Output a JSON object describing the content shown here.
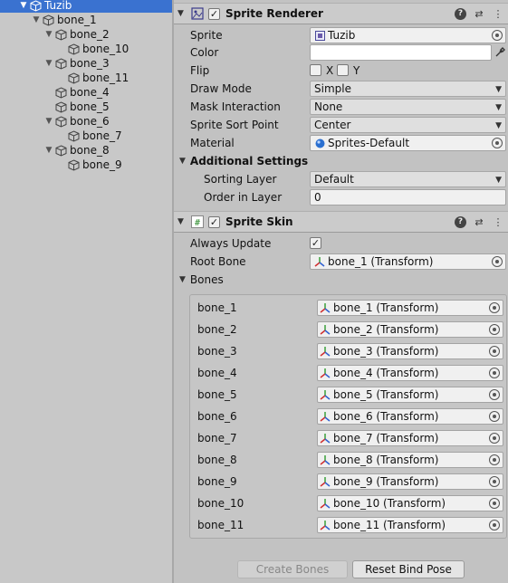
{
  "hierarchy": [
    {
      "name": "Tuzib",
      "depth": 0,
      "expanded": true,
      "selected": true
    },
    {
      "name": "bone_1",
      "depth": 1,
      "expanded": true
    },
    {
      "name": "bone_2",
      "depth": 2,
      "expanded": true
    },
    {
      "name": "bone_10",
      "depth": 3,
      "expanded": null
    },
    {
      "name": "bone_3",
      "depth": 2,
      "expanded": true
    },
    {
      "name": "bone_11",
      "depth": 3,
      "expanded": null
    },
    {
      "name": "bone_4",
      "depth": 2,
      "expanded": null
    },
    {
      "name": "bone_5",
      "depth": 2,
      "expanded": null
    },
    {
      "name": "bone_6",
      "depth": 2,
      "expanded": true
    },
    {
      "name": "bone_7",
      "depth": 3,
      "expanded": null
    },
    {
      "name": "bone_8",
      "depth": 2,
      "expanded": true
    },
    {
      "name": "bone_9",
      "depth": 3,
      "expanded": null
    }
  ],
  "sprite_renderer": {
    "title": "Sprite Renderer",
    "enabled": true,
    "sprite_label": "Sprite",
    "sprite_value": "Tuzib",
    "color_label": "Color",
    "color_value": "#ffffff",
    "flip_label": "Flip",
    "flip_x": "X",
    "flip_y": "Y",
    "draw_mode_label": "Draw Mode",
    "draw_mode_value": "Simple",
    "mask_label": "Mask Interaction",
    "mask_value": "None",
    "sort_point_label": "Sprite Sort Point",
    "sort_point_value": "Center",
    "material_label": "Material",
    "material_value": "Sprites-Default",
    "additional_label": "Additional Settings",
    "sorting_layer_label": "Sorting Layer",
    "sorting_layer_value": "Default",
    "order_label": "Order in Layer",
    "order_value": "0"
  },
  "sprite_skin": {
    "title": "Sprite Skin",
    "enabled": true,
    "always_update_label": "Always Update",
    "always_update_checked": true,
    "root_bone_label": "Root Bone",
    "root_bone_value": "bone_1 (Transform)",
    "bones_label": "Bones",
    "bones": [
      {
        "label": "bone_1",
        "value": "bone_1 (Transform)"
      },
      {
        "label": "bone_2",
        "value": "bone_2 (Transform)"
      },
      {
        "label": "bone_3",
        "value": "bone_3 (Transform)"
      },
      {
        "label": "bone_4",
        "value": "bone_4 (Transform)"
      },
      {
        "label": "bone_5",
        "value": "bone_5 (Transform)"
      },
      {
        "label": "bone_6",
        "value": "bone_6 (Transform)"
      },
      {
        "label": "bone_7",
        "value": "bone_7 (Transform)"
      },
      {
        "label": "bone_8",
        "value": "bone_8 (Transform)"
      },
      {
        "label": "bone_9",
        "value": "bone_9 (Transform)"
      },
      {
        "label": "bone_10",
        "value": "bone_10 (Transform)"
      },
      {
        "label": "bone_11",
        "value": "bone_11 (Transform)"
      }
    ],
    "create_bones_label": "Create Bones",
    "reset_bind_pose_label": "Reset Bind Pose"
  }
}
